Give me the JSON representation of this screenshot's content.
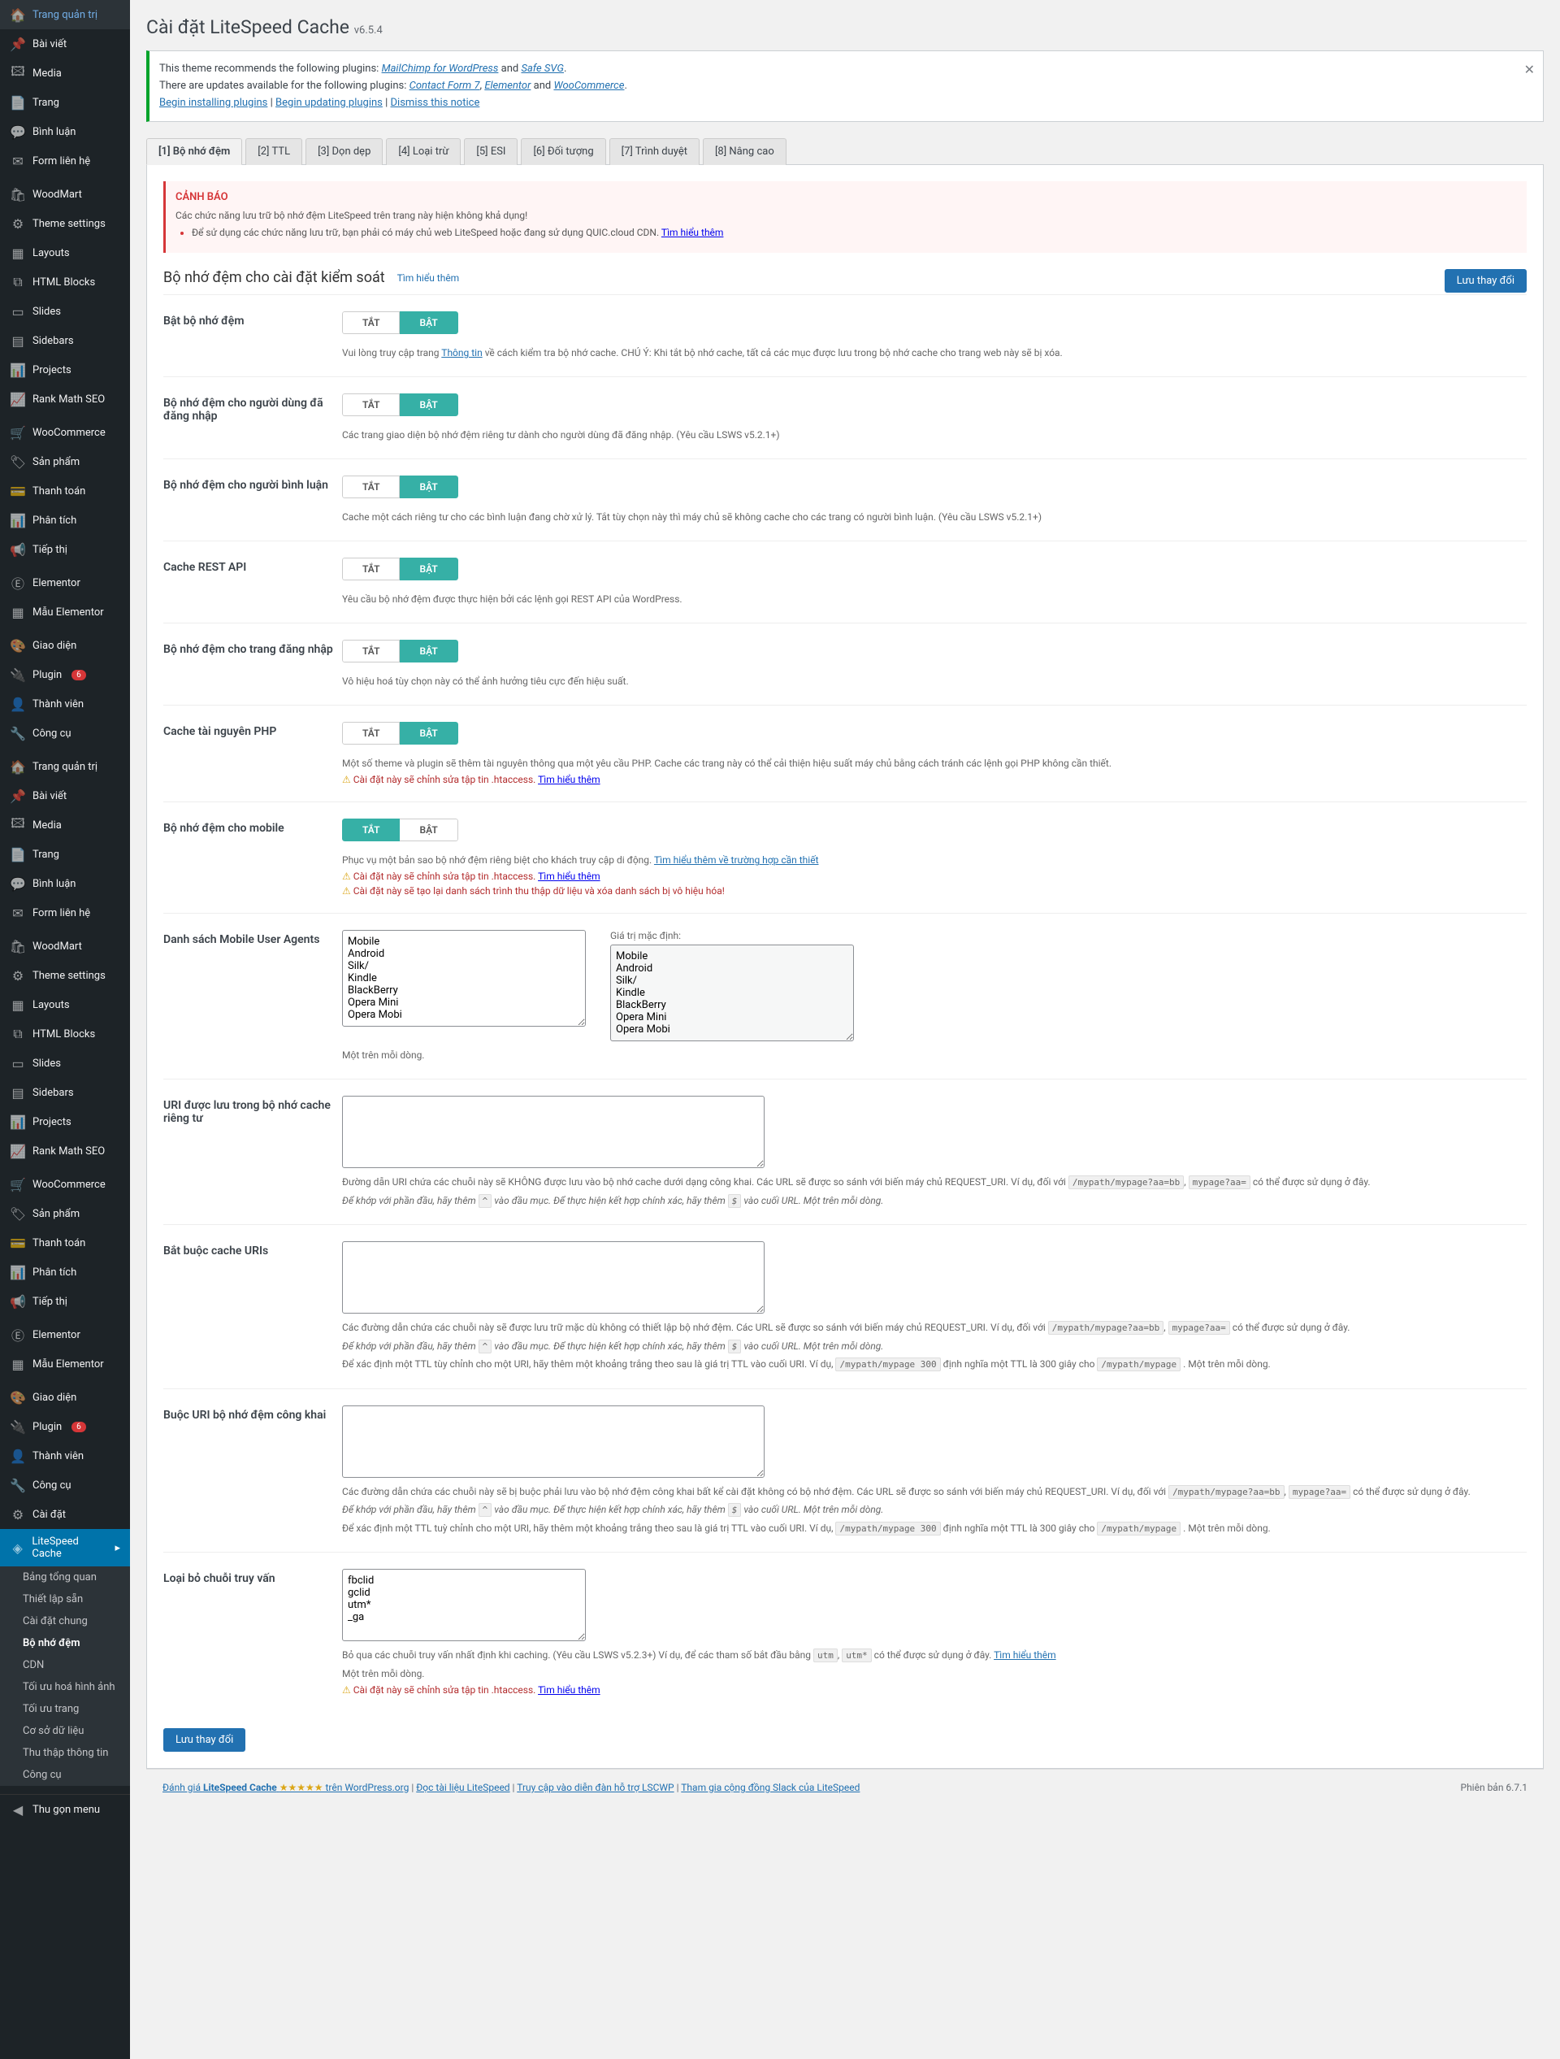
{
  "sidebar1": [
    {
      "icon": "🏠",
      "label": "Trang quản trị"
    },
    {
      "icon": "📌",
      "label": "Bài viết"
    },
    {
      "icon": "🖾",
      "label": "Media"
    },
    {
      "icon": "📄",
      "label": "Trang"
    },
    {
      "icon": "💬",
      "label": "Bình luận"
    },
    {
      "icon": "✉",
      "label": "Form liên hệ"
    }
  ],
  "sidebar2": [
    {
      "icon": "🛍",
      "label": "WoodMart"
    },
    {
      "icon": "⚙",
      "label": "Theme settings"
    },
    {
      "icon": "▦",
      "label": "Layouts"
    },
    {
      "icon": "⧉",
      "label": "HTML Blocks"
    },
    {
      "icon": "▭",
      "label": "Slides"
    },
    {
      "icon": "▤",
      "label": "Sidebars"
    },
    {
      "icon": "📊",
      "label": "Projects"
    },
    {
      "icon": "📈",
      "label": "Rank Math SEO"
    }
  ],
  "sidebar3": [
    {
      "icon": "🛒",
      "label": "WooCommerce"
    },
    {
      "icon": "🏷",
      "label": "Sản phẩm"
    },
    {
      "icon": "💳",
      "label": "Thanh toán"
    },
    {
      "icon": "📊",
      "label": "Phân tích"
    },
    {
      "icon": "📢",
      "label": "Tiếp thị"
    }
  ],
  "sidebar4": [
    {
      "icon": "Ⓔ",
      "label": "Elementor"
    },
    {
      "icon": "▦",
      "label": "Mẫu Elementor"
    }
  ],
  "sidebar5": [
    {
      "icon": "🎨",
      "label": "Giao diện"
    },
    {
      "icon": "🔌",
      "label": "Plugin",
      "badge": "6"
    },
    {
      "icon": "👤",
      "label": "Thành viên"
    },
    {
      "icon": "🔧",
      "label": "Công cụ"
    }
  ],
  "sidebar6": [
    {
      "icon": "🏠",
      "label": "Trang quản trị"
    },
    {
      "icon": "📌",
      "label": "Bài viết"
    },
    {
      "icon": "🖾",
      "label": "Media"
    },
    {
      "icon": "📄",
      "label": "Trang"
    },
    {
      "icon": "💬",
      "label": "Bình luận"
    },
    {
      "icon": "✉",
      "label": "Form liên hệ"
    }
  ],
  "sidebar7": [
    {
      "icon": "🛍",
      "label": "WoodMart"
    },
    {
      "icon": "⚙",
      "label": "Theme settings"
    },
    {
      "icon": "▦",
      "label": "Layouts"
    },
    {
      "icon": "⧉",
      "label": "HTML Blocks"
    },
    {
      "icon": "▭",
      "label": "Slides"
    },
    {
      "icon": "▤",
      "label": "Sidebars"
    },
    {
      "icon": "📊",
      "label": "Projects"
    },
    {
      "icon": "📈",
      "label": "Rank Math SEO"
    }
  ],
  "sidebar8": [
    {
      "icon": "🛒",
      "label": "WooCommerce"
    },
    {
      "icon": "🏷",
      "label": "Sản phẩm"
    },
    {
      "icon": "💳",
      "label": "Thanh toán"
    },
    {
      "icon": "📊",
      "label": "Phân tích"
    },
    {
      "icon": "📢",
      "label": "Tiếp thị"
    }
  ],
  "sidebar9": [
    {
      "icon": "Ⓔ",
      "label": "Elementor"
    },
    {
      "icon": "▦",
      "label": "Mẫu Elementor"
    }
  ],
  "sidebar10": [
    {
      "icon": "🎨",
      "label": "Giao diện"
    },
    {
      "icon": "🔌",
      "label": "Plugin",
      "badge": "6"
    },
    {
      "icon": "👤",
      "label": "Thành viên"
    },
    {
      "icon": "🔧",
      "label": "Công cụ"
    },
    {
      "icon": "⚙",
      "label": "Cài đặt"
    }
  ],
  "lscache_item": {
    "icon": "◈",
    "label": "LiteSpeed Cache"
  },
  "submenu": [
    "Bảng tổng quan",
    "Thiết lập sẵn",
    "Cài đặt chung",
    "Bộ nhớ đệm",
    "CDN",
    "Tối ưu hoá hình ảnh",
    "Tối ưu trang",
    "Cơ sở dữ liệu",
    "Thu thập thông tin",
    "Công cụ"
  ],
  "submenu_active_index": 3,
  "collapse": {
    "label": "Thu gọn menu"
  },
  "page_title": "Cài đặt LiteSpeed Cache",
  "version_label": "v6.5.4",
  "notice": {
    "line1_a": "This theme recommends the following plugins: ",
    "link1": "MailChimp for WordPress",
    "and1": " and ",
    "link2": "Safe SVG",
    "line2_a": "There are updates available for the following plugins: ",
    "link3": "Contact Form 7",
    "comma": ", ",
    "link4": "Elementor",
    "and2": " and ",
    "link5": "WooCommerce",
    "action1": "Begin installing plugins",
    "sep": " | ",
    "action2": "Begin updating plugins",
    "action3": "Dismiss this notice"
  },
  "tabs": [
    "[1] Bộ nhớ đệm",
    "[2] TTL",
    "[3] Dọn dẹp",
    "[4] Loại trừ",
    "[5] ESI",
    "[6] Đối tượng",
    "[7] Trình duyệt",
    "[8] Nâng cao"
  ],
  "alert": {
    "title": "CẢNH BÁO",
    "line1": "Các chức năng lưu trữ bộ nhớ đệm LiteSpeed trên trang này hiện không khả dụng!",
    "line2_a": "Để sử dụng các chức năng lưu trữ, bạn phải có máy chủ web LiteSpeed hoặc đang sử dụng QUIC.cloud CDN. ",
    "line2_link": "Tìm hiểu thêm"
  },
  "section_title": "Bộ nhớ đệm cho cài đặt kiểm soát",
  "learn_more": "Tìm hiểu thêm",
  "save_label": "Lưu thay đổi",
  "off_label": "TẮT",
  "on_label": "BẬT",
  "settings": {
    "enable_cache": {
      "label": "Bật bộ nhớ đệm",
      "desc_a": "Vui lòng truy cập trang ",
      "desc_link": "Thông tin",
      "desc_b": " về cách kiểm tra bộ nhớ cache. CHÚ Ý: Khi tắt bộ nhớ cache, tất cả các mục được lưu trong bộ nhớ cache cho trang web này sẽ bị xóa."
    },
    "cache_logged": {
      "label": "Bộ nhớ đệm cho người dùng đã đăng nhập",
      "desc": "Các trang giao diện bộ nhớ đệm riêng tư dành cho người dùng đã đăng nhập. (Yêu cầu LSWS v5.2.1+)"
    },
    "cache_commenters": {
      "label": "Bộ nhớ đệm cho người bình luận",
      "desc": "Cache một cách riêng tư cho các bình luận đang chờ xử lý. Tắt tùy chọn này thì máy chủ sẽ không cache cho các trang có người bình luận. (Yêu cầu LSWS v5.2.1+)"
    },
    "cache_rest": {
      "label": "Cache REST API",
      "desc": "Yêu cầu bộ nhớ đệm được thực hiện bởi các lệnh gọi REST API của WordPress."
    },
    "cache_login": {
      "label": "Bộ nhớ đệm cho trang đăng nhập",
      "desc": "Vô hiệu hoá tùy chọn này có thể ảnh hưởng tiêu cực đến hiệu suất."
    },
    "cache_php": {
      "label": "Cache tài nguyên PHP",
      "desc_a": "Một số theme và plugin sẽ thêm tài nguyên thông qua một yêu cầu PHP. Cache các trang này có thể cải thiện hiệu suất máy chủ bằng cách tránh các lệnh gọi PHP không cần thiết.",
      "warn_a": "Cài đặt này sẽ chỉnh sửa tập tin .htaccess. ",
      "warn_link": "Tìm hiểu thêm"
    },
    "cache_mobile": {
      "label": "Bộ nhớ đệm cho mobile",
      "desc_a": "Phục vụ một bản sao bộ nhớ đệm riêng biệt cho khách truy cập di động. ",
      "desc_link": "Tìm hiểu thêm về trường hợp cần thiết",
      "warn1_a": "Cài đặt này sẽ chỉnh sửa tập tin .htaccess. ",
      "warn1_link": "Tìm hiểu thêm",
      "warn2": "Cài đặt này sẽ tạo lại danh sách trình thu thập dữ liệu và xóa danh sách bị vô hiệu hóa!"
    },
    "mobile_agents": {
      "label": "Danh sách Mobile User Agents",
      "default_label": "Giá trị mặc định:",
      "value": "Mobile\nAndroid\nSilk/\nKindle\nBlackBerry\nOpera Mini\nOpera Mobi",
      "default_value": "Mobile\nAndroid\nSilk/\nKindle\nBlackBerry\nOpera Mini\nOpera Mobi",
      "desc": "Một trên mỗi dòng."
    },
    "private_uris": {
      "label": "URI được lưu trong bộ nhớ cache riêng tư",
      "desc_a": "Đường dẫn URI chứa các chuỗi này sẽ KHÔNG được lưu vào bộ nhớ cache dưới dạng công khai. Các URL sẽ được so sánh với biến máy chủ REQUEST_URI. Ví dụ, đối với ",
      "chip1": "/mypath/mypage?aa=bb",
      "chip2": "mypage?aa=",
      "desc_b": " có thể được sử dụng ở đây.",
      "desc_line2_a": "Để khớp với phần đầu, hãy thêm ",
      "chip3": "^",
      "desc_line2_b": " vào đầu mục. Để thực hiện kết hợp chính xác, hãy thêm ",
      "chip4": "$",
      "desc_line2_c": " vào cuối URL. Một trên mỗi dòng."
    },
    "force_cache": {
      "label": "Bắt buộc cache URIs",
      "desc_a": "Các đường dẫn chứa các chuỗi này sẽ được lưu trữ mặc dù không có thiết lập bộ nhớ đệm. Các URL sẽ được so sánh với biến máy chủ REQUEST_URI. Ví dụ, đối với ",
      "chip1": "/mypath/mypage?aa=bb",
      "chip2": "mypage?aa=",
      "desc_b": " có thể được sử dụng ở đây.",
      "line2_a": "Để khớp với phần đầu, hãy thêm ",
      "chip3": "^",
      "line2_b": " vào đầu mục. Để thực hiện kết hợp chính xác, hãy thêm ",
      "chip4": "$",
      "line2_c": " vào cuối URL. Một trên mỗi dòng.",
      "line3_a": "Để xác định một TTL tùy chỉnh cho một URI, hãy thêm một khoảng trắng theo sau là giá trị TTL vào cuối URI. Ví dụ, ",
      "chip5": "/mypath/mypage 300",
      "line3_b": " định nghĩa một TTL là 300 giây cho ",
      "chip6": "/mypath/mypage",
      "line3_c": ". Một trên mỗi dòng."
    },
    "force_public": {
      "label": "Buộc URI bộ nhớ đệm công khai",
      "desc_a": "Các đường dẫn chứa các chuỗi này sẽ bị buộc phải lưu vào bộ nhớ đệm công khai bất kể cài đặt không có bộ nhớ đệm. Các URL sẽ được so sánh với biến máy chủ REQUEST_URI. Ví dụ, đối với ",
      "chip1": "/mypath/mypage?aa=bb",
      "chip2": "mypage?aa=",
      "desc_b": " có thể được sử dụng ở đây.",
      "line2_a": "Để khớp với phần đầu, hãy thêm ",
      "chip3": "^",
      "line2_b": " vào đầu mục. Để thực hiện kết hợp chính xác, hãy thêm ",
      "chip4": "$",
      "line2_c": " vào cuối URL. Một trên mỗi dòng.",
      "line3_a": "Để xác định một TTL tuỳ chỉnh cho một URI, hãy thêm một khoảng trắng theo sau là giá trị TTL vào cuối URI. Ví dụ, ",
      "chip5": "/mypath/mypage 300",
      "line3_b": " định nghĩa một TTL là 300 giây cho ",
      "chip6": "/mypath/mypage",
      "line3_c": ". Một trên mỗi dòng."
    },
    "drop_query": {
      "label": "Loại bỏ chuỗi truy vấn",
      "value": "fbclid\ngclid\nutm*\n_ga",
      "desc_a": "Bỏ qua các chuỗi truy vấn nhất định khi caching. (Yêu cầu LSWS v5.2.3+) Ví dụ, để các tham số bắt đầu bằng ",
      "chip1": "utm",
      "chip2": "utm*",
      "desc_b": " có thể được sử dụng ở đây. ",
      "desc_link": "Tìm hiểu thêm",
      "desc_2": "Một trên mỗi dòng.",
      "warn_a": "Cài đặt này sẽ chỉnh sửa tập tin .htaccess. ",
      "warn_link": "Tìm hiểu thêm"
    }
  },
  "footer": {
    "rate_a": "Đánh giá ",
    "rate_b": "LiteSpeed Cache",
    "rate_c": " trên WordPress.org",
    "link2": "Đọc tài liệu LiteSpeed",
    "link3": "Truy cập vào diễn đàn hỗ trợ LSCWP",
    "link4": "Tham gia cộng đồng Slack của LiteSpeed",
    "version": "Phiên bản 6.7.1"
  }
}
